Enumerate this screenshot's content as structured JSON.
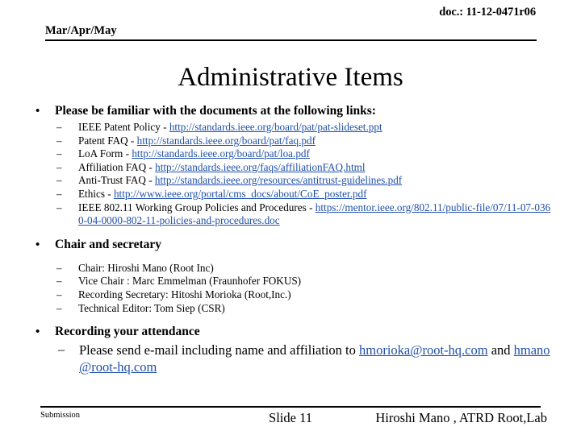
{
  "header": {
    "doc_id": "doc.: 11-12-0471r06",
    "month_label": "Mar/Apr/May"
  },
  "title": "Administrative Items",
  "colors": {
    "link": "#2050aa",
    "text": "#000000",
    "background": "#ffffff"
  },
  "markers": {
    "bullet": "•",
    "dash": "–"
  },
  "sections": [
    {
      "heading": "Please be familiar with the documents at the following links:",
      "items": [
        {
          "label": "IEEE Patent Policy - ",
          "link": "http://standards.ieee.org/board/pat/pat-slideset.ppt"
        },
        {
          "label": "Patent FAQ - ",
          "link": "http://standards.ieee.org/board/pat/faq.pdf"
        },
        {
          "label": "LoA Form - ",
          "link": "http://standards.ieee.org/board/pat/loa.pdf"
        },
        {
          "label": "Affiliation FAQ - ",
          "link": "http://standards.ieee.org/faqs/affiliationFAQ.html"
        },
        {
          "label": "Anti-Trust FAQ - ",
          "link": "http://standards.ieee.org/resources/antitrust-guidelines.pdf"
        },
        {
          "label": "Ethics - ",
          "link": "http://www.ieee.org/portal/cms_docs/about/CoE_poster.pdf"
        },
        {
          "label": "IEEE 802.11 Working Group Policies and Procedures - ",
          "link": "https://mentor.ieee.org/802.11/public-file/07/11-07-0360-04-0000-802-11-policies-and-procedures.doc"
        }
      ]
    },
    {
      "heading": "Chair and secretary",
      "items": [
        {
          "label": "Chair: Hiroshi Mano (Root Inc)",
          "link": ""
        },
        {
          "label": "Vice Chair : Marc Emmelman (Fraunhofer FOKUS)",
          "link": ""
        },
        {
          "label": "Recording Secretary: Hitoshi Morioka (Root,Inc.)",
          "link": ""
        },
        {
          "label": "Technical Editor: Tom Siep (CSR)",
          "link": ""
        }
      ]
    },
    {
      "heading": "Recording your attendance",
      "items": [
        {
          "label": "Please send e-mail including name and affiliation to ",
          "link": "hmorioka@root-hq.com",
          "label2": " and ",
          "link2": "hmano@root-hq.com"
        }
      ]
    }
  ],
  "footer": {
    "submission": "Submission",
    "slide": "Slide 11",
    "author": "Hiroshi Mano , ATRD Root,Lab"
  }
}
